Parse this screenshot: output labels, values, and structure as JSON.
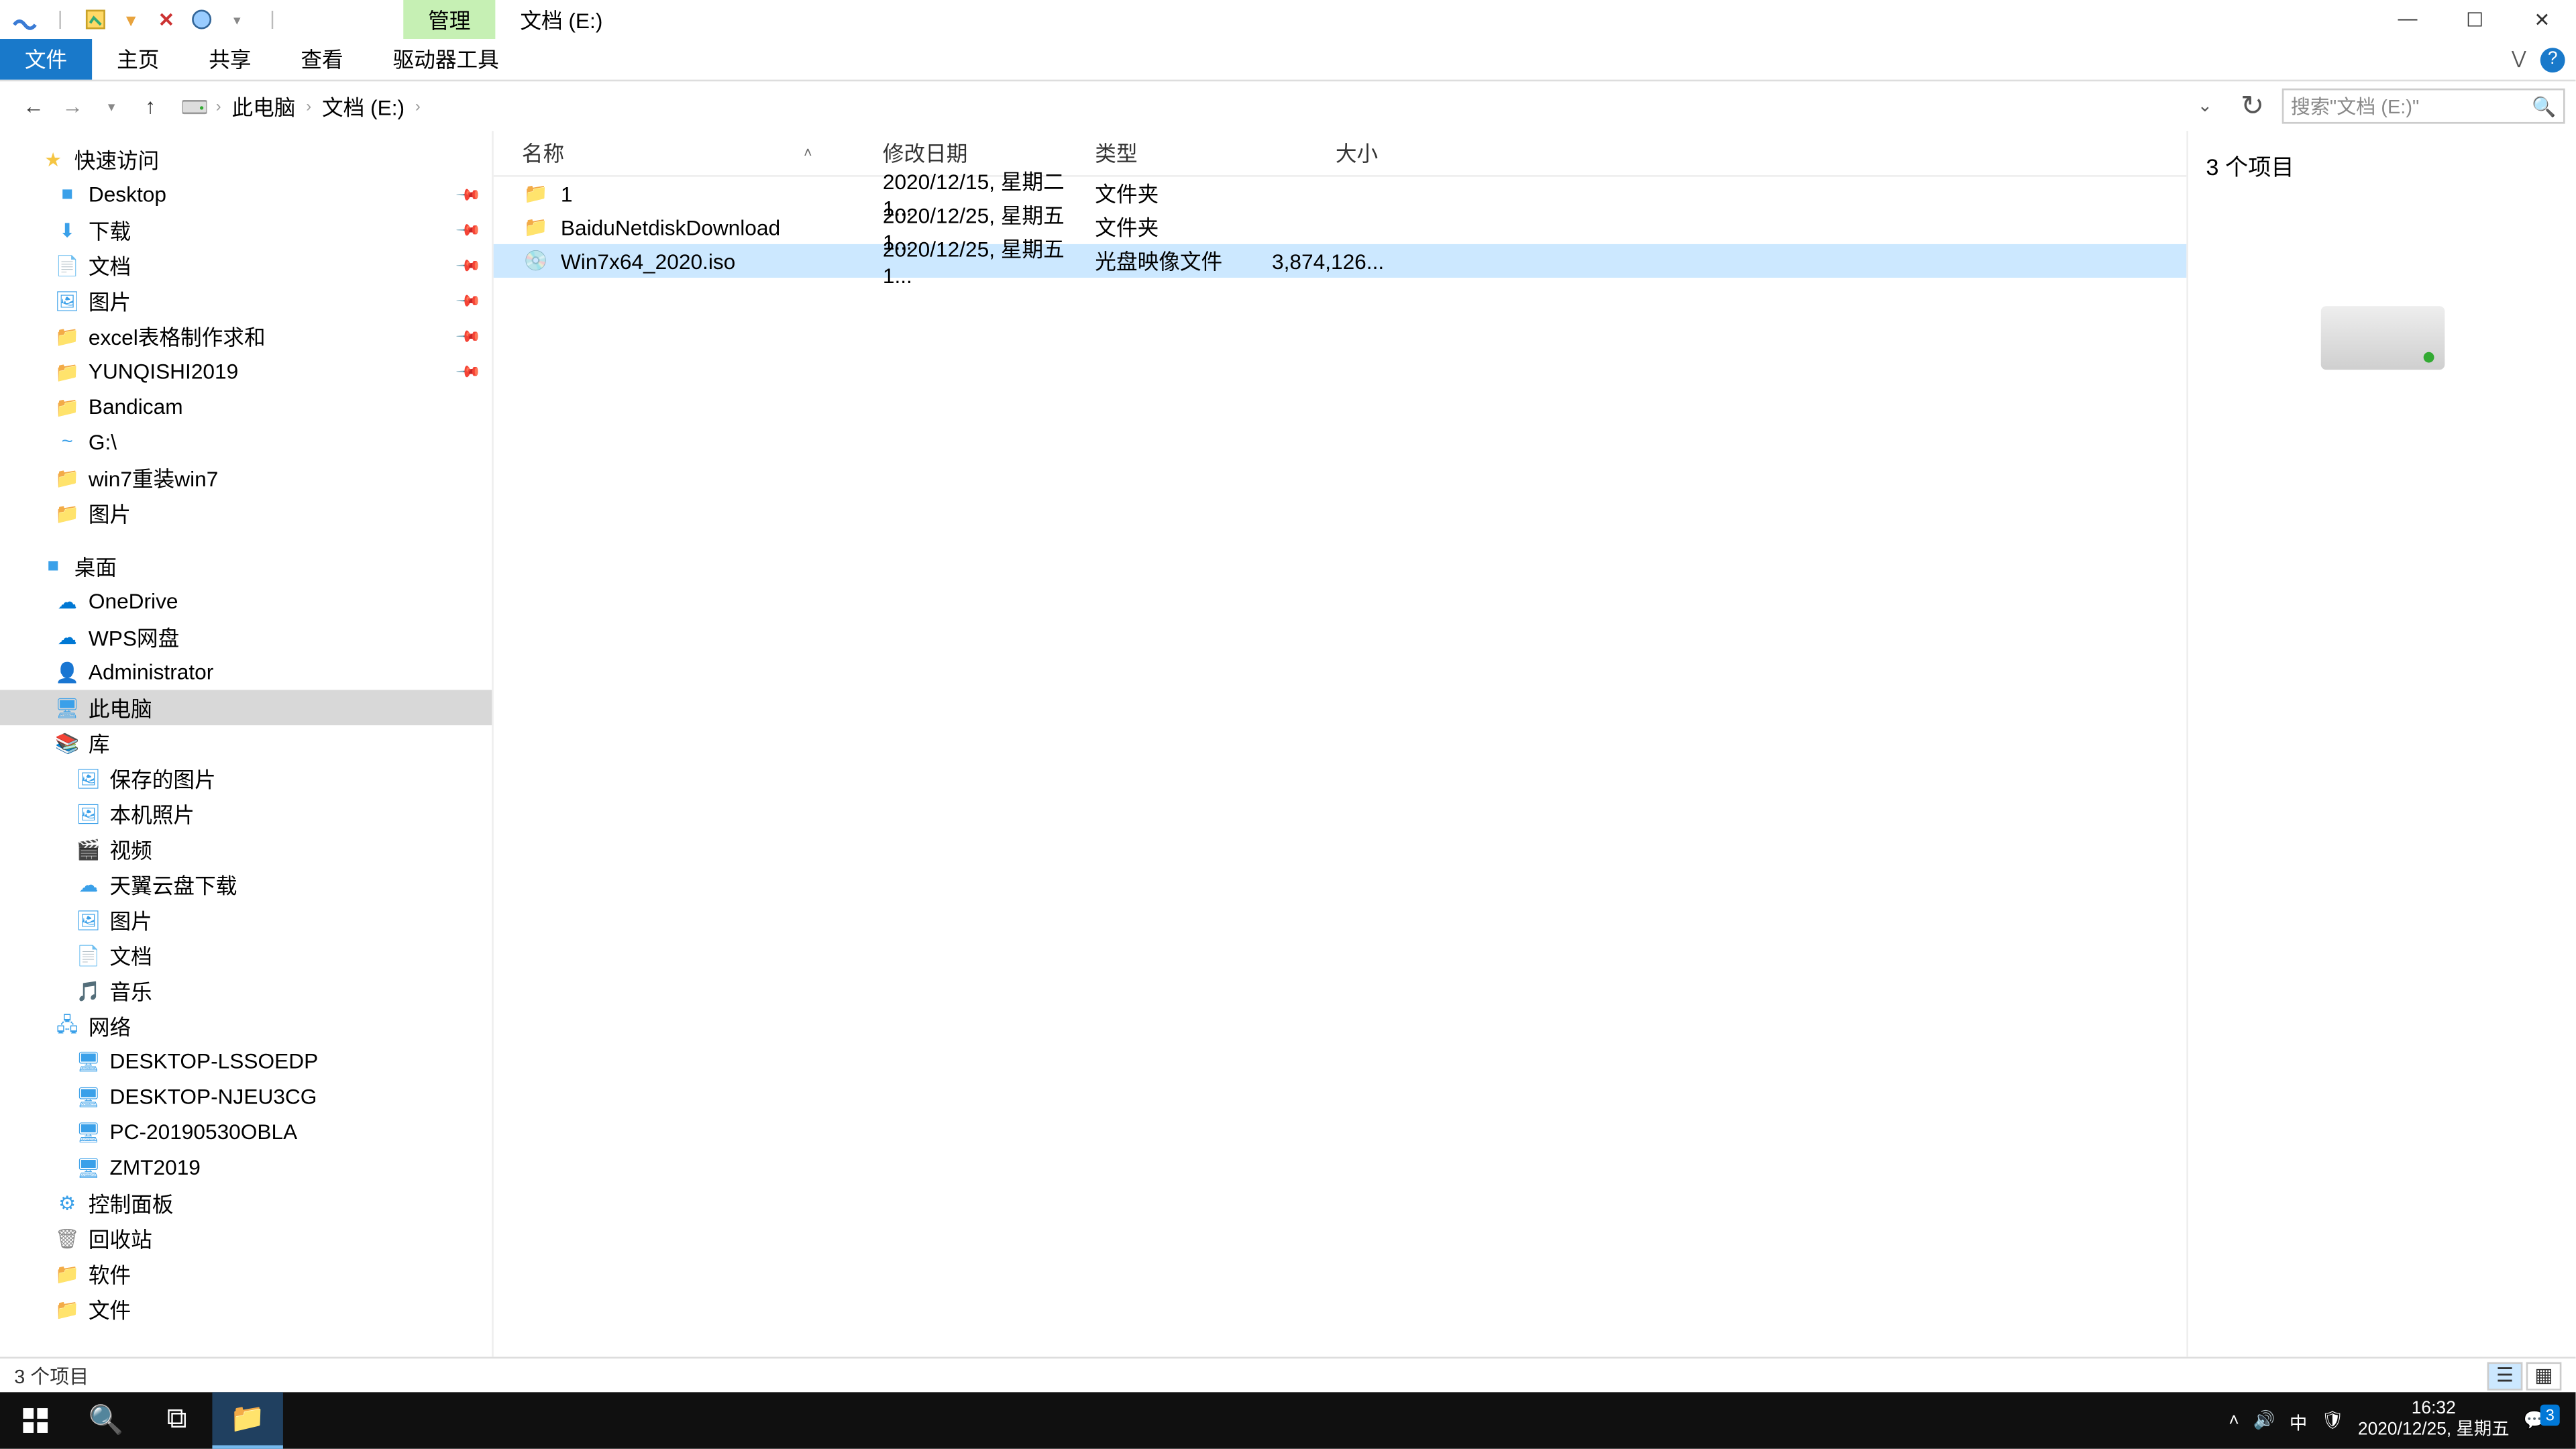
{
  "titlebar": {
    "tab_manage": "管理",
    "tab_location": "文档 (E:)"
  },
  "ribbon": {
    "file": "文件",
    "home": "主页",
    "share": "共享",
    "view": "查看",
    "drivetools": "驱动器工具"
  },
  "address": {
    "crumb1": "此电脑",
    "crumb2": "文档 (E:)",
    "search_placeholder": "搜索\"文档 (E:)\""
  },
  "columns": {
    "name": "名称",
    "date": "修改日期",
    "type": "类型",
    "size": "大小"
  },
  "rows": [
    {
      "name": "1",
      "date": "2020/12/15, 星期二 1...",
      "type": "文件夹",
      "size": "",
      "icon": "folder",
      "selected": false
    },
    {
      "name": "BaiduNetdiskDownload",
      "date": "2020/12/25, 星期五 1...",
      "type": "文件夹",
      "size": "",
      "icon": "folder",
      "selected": false
    },
    {
      "name": "Win7x64_2020.iso",
      "date": "2020/12/25, 星期五 1...",
      "type": "光盘映像文件",
      "size": "3,874,126...",
      "icon": "iso",
      "selected": true
    }
  ],
  "sidebar": {
    "quick_access": "快速访问",
    "desktop": "Desktop",
    "downloads": "下载",
    "documents": "文档",
    "pictures": "图片",
    "excel": "excel表格制作求和",
    "yunqishi": "YUNQISHI2019",
    "bandicam": "Bandicam",
    "gdrive": "G:\\",
    "win7reinstall": "win7重装win7",
    "pictures2": "图片",
    "desktop_root": "桌面",
    "onedrive": "OneDrive",
    "wps": "WPS网盘",
    "admin": "Administrator",
    "thispc": "此电脑",
    "libraries": "库",
    "saved_pics": "保存的图片",
    "camera_roll": "本机照片",
    "videos": "视频",
    "tianyi": "天翼云盘下载",
    "lib_pictures": "图片",
    "lib_docs": "文档",
    "lib_music": "音乐",
    "network": "网络",
    "pc1": "DESKTOP-LSSOEDP",
    "pc2": "DESKTOP-NJEU3CG",
    "pc3": "PC-20190530OBLA",
    "pc4": "ZMT2019",
    "control_panel": "控制面板",
    "recycle": "回收站",
    "software": "软件",
    "files": "文件"
  },
  "preview": {
    "count": "3 个项目"
  },
  "status": {
    "text": "3 个项目"
  },
  "tray": {
    "ime": "中",
    "time": "16:32",
    "date": "2020/12/25, 星期五",
    "notif_count": "3"
  }
}
